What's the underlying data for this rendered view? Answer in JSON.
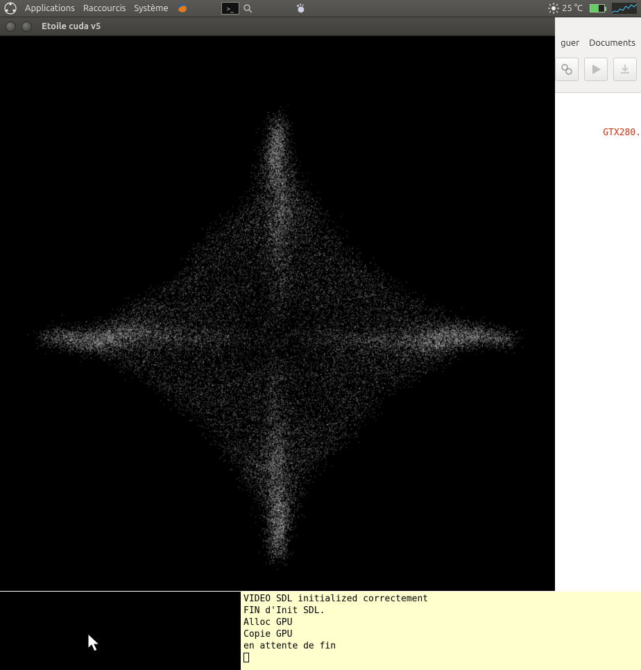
{
  "panel": {
    "menu_applications": "Applications",
    "menu_shortcuts": "Raccourcis",
    "menu_system": "Système",
    "weather_temp": "25 °C"
  },
  "ide": {
    "menu_debug_fragment": "guer",
    "menu_documents": "Documents",
    "red_text": "GTX280."
  },
  "window": {
    "title": "Etoile cuda v5"
  },
  "terminal": {
    "line1": "VIDEO SDL initialized correctement",
    "line2": "FIN d'Init SDL.",
    "line3": "Alloc GPU",
    "line4": "Copie GPU",
    "line5": "en attente de fin"
  }
}
